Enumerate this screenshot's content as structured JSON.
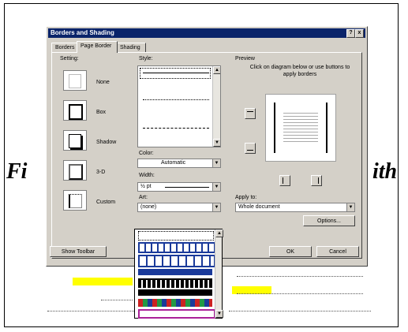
{
  "background": {
    "heading_left": "Fi",
    "heading_right": "ith",
    "text_lines": [
      "Fi",
      "Fi",
      "Fi"
    ],
    "highlight_color": "#ffff00"
  },
  "dialog": {
    "title": "Borders and Shading",
    "window_buttons": [
      "?",
      "x"
    ],
    "tabs": [
      "Borders",
      "Page Border",
      "Shading"
    ],
    "active_tab": "Page Border",
    "setting": {
      "label": "Setting:",
      "items": [
        "None",
        "Box",
        "Shadow",
        "3-D",
        "Custom"
      ]
    },
    "style": {
      "label": "Style:"
    },
    "color": {
      "label": "Color:",
      "value": "Automatic"
    },
    "width": {
      "label": "Width:",
      "value": "½ pt"
    },
    "art": {
      "label": "Art:",
      "value": "(none)"
    },
    "preview": {
      "label": "Preview",
      "instructions": "Click on diagram below or use buttons to apply borders"
    },
    "apply_to": {
      "label": "Apply to:",
      "value": "Whole document"
    },
    "buttons": {
      "options": "Options...",
      "show_toolbar": "Show Toolbar",
      "ok": "OK",
      "cancel": "Cancel"
    }
  },
  "colors": {
    "dialog_bg": "#d4d0c8",
    "titlebar": "#0a246a",
    "art_blue": "#1a3a9a",
    "art_red": "#cc2222",
    "art_green": "#229944",
    "art_magenta": "#aa2299"
  }
}
